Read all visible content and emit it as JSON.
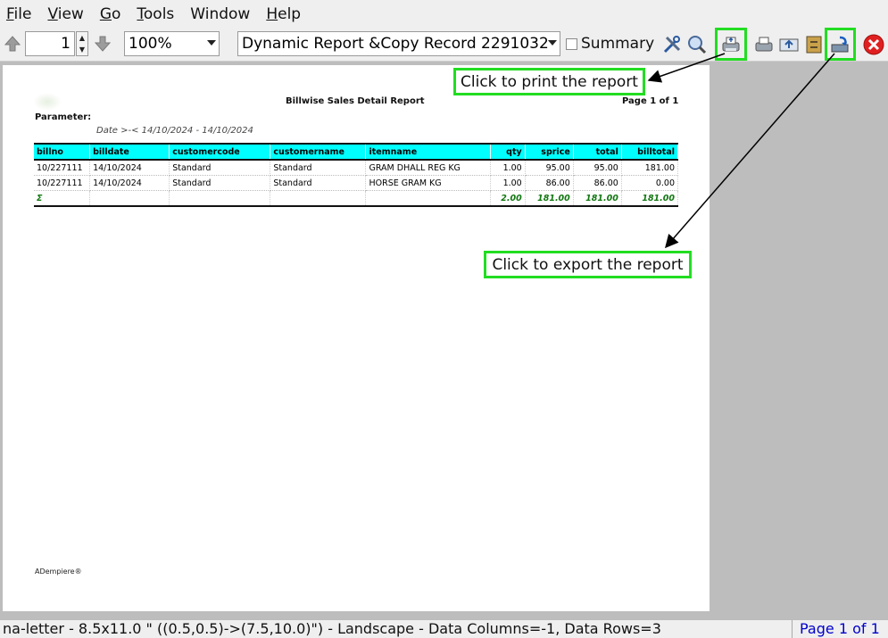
{
  "menu": [
    "File",
    "View",
    "Go",
    "Tools",
    "Window",
    "Help"
  ],
  "menu_mnemonic": [
    "F",
    "V",
    "G",
    "T",
    "",
    "H"
  ],
  "menu_rest": [
    "ile",
    "iew",
    "o",
    "ools",
    "Window",
    "elp"
  ],
  "toolbar": {
    "page_number": "1",
    "zoom": "100%",
    "report_select": "Dynamic Report &Copy Record 2291032",
    "summary_label": "Summary"
  },
  "report": {
    "title": "Billwise Sales Detail Report",
    "page": "Page 1 of 1",
    "parameter_label": "Parameter:",
    "parameter_line": "Date  >-<  14/10/2024 - 14/10/2024",
    "columns": [
      "billno",
      "billdate",
      "customercode",
      "customername",
      "itemname",
      "qty",
      "sprice",
      "total",
      "billtotal"
    ],
    "rows": [
      [
        "10/227111",
        "14/10/2024",
        "Standard",
        "Standard",
        "GRAM  DHALL REG KG",
        "1.00",
        "95.00",
        "95.00",
        "181.00"
      ],
      [
        "10/227111",
        "14/10/2024",
        "Standard",
        "Standard",
        "HORSE GRAM KG",
        "1.00",
        "86.00",
        "86.00",
        "0.00"
      ]
    ],
    "sum_row": [
      "Σ",
      "",
      "",
      "",
      "",
      "2.00",
      "181.00",
      "181.00",
      "181.00"
    ],
    "footer_logo": "ADempiere®"
  },
  "callouts": {
    "print": "Click to print the report",
    "export": "Click to export the report"
  },
  "status": {
    "text": "na-letter - 8.5x11.0 \" ((0.5,0.5)->(7.5,10.0)\") - Landscape - Data Columns=-1, Data Rows=3",
    "page": "Page 1 of 1"
  },
  "colors": {
    "highlight": "#22dd22",
    "table_header": "#00ffff",
    "sum_text": "#117711"
  }
}
